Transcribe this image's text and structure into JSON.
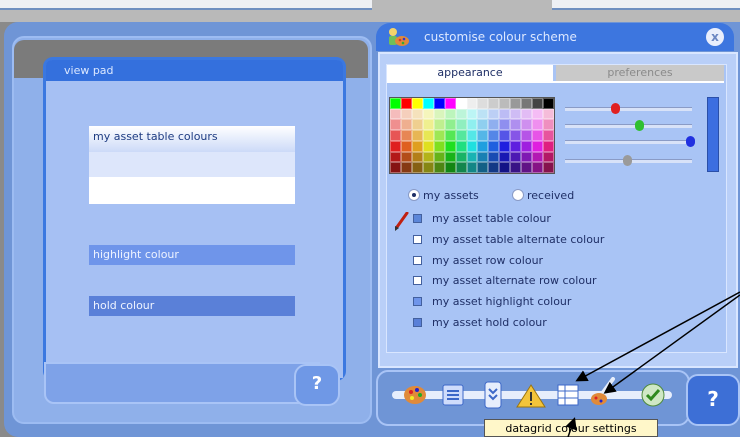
{
  "view_pad": {
    "title": "view pad",
    "table_colours_label": "my asset table colours",
    "highlight_label": "highlight colour",
    "hold_label": "hold colour",
    "help_label": "?"
  },
  "dialog": {
    "title": "customise colour scheme",
    "close_label": "x",
    "tabs": [
      {
        "label": "appearance",
        "active": true
      },
      {
        "label": "preferences",
        "active": false
      }
    ],
    "radio": [
      {
        "label": "my assets",
        "selected": true
      },
      {
        "label": "received",
        "selected": false
      }
    ],
    "items": [
      {
        "label": "my asset table colour",
        "swatch": "#5b86d9"
      },
      {
        "label": "my asset table alternate colour",
        "swatch": "#ffffff"
      },
      {
        "label": "my asset row colour",
        "swatch": "#ffffff"
      },
      {
        "label": "my asset alternate row colour",
        "swatch": "#ffffff"
      },
      {
        "label": "my asset highlight colour",
        "swatch": "#6f95ea"
      },
      {
        "label": "my asset hold colour",
        "swatch": "#5a80d8"
      }
    ],
    "help_label": "?"
  },
  "toolbar": {
    "tooltip": "datagrid colour settings",
    "icons": [
      "palette-icon",
      "list-icon",
      "expand-icon",
      "warning-icon",
      "datagrid-icon",
      "paint-brush-icon",
      "confirm-check-icon"
    ]
  }
}
